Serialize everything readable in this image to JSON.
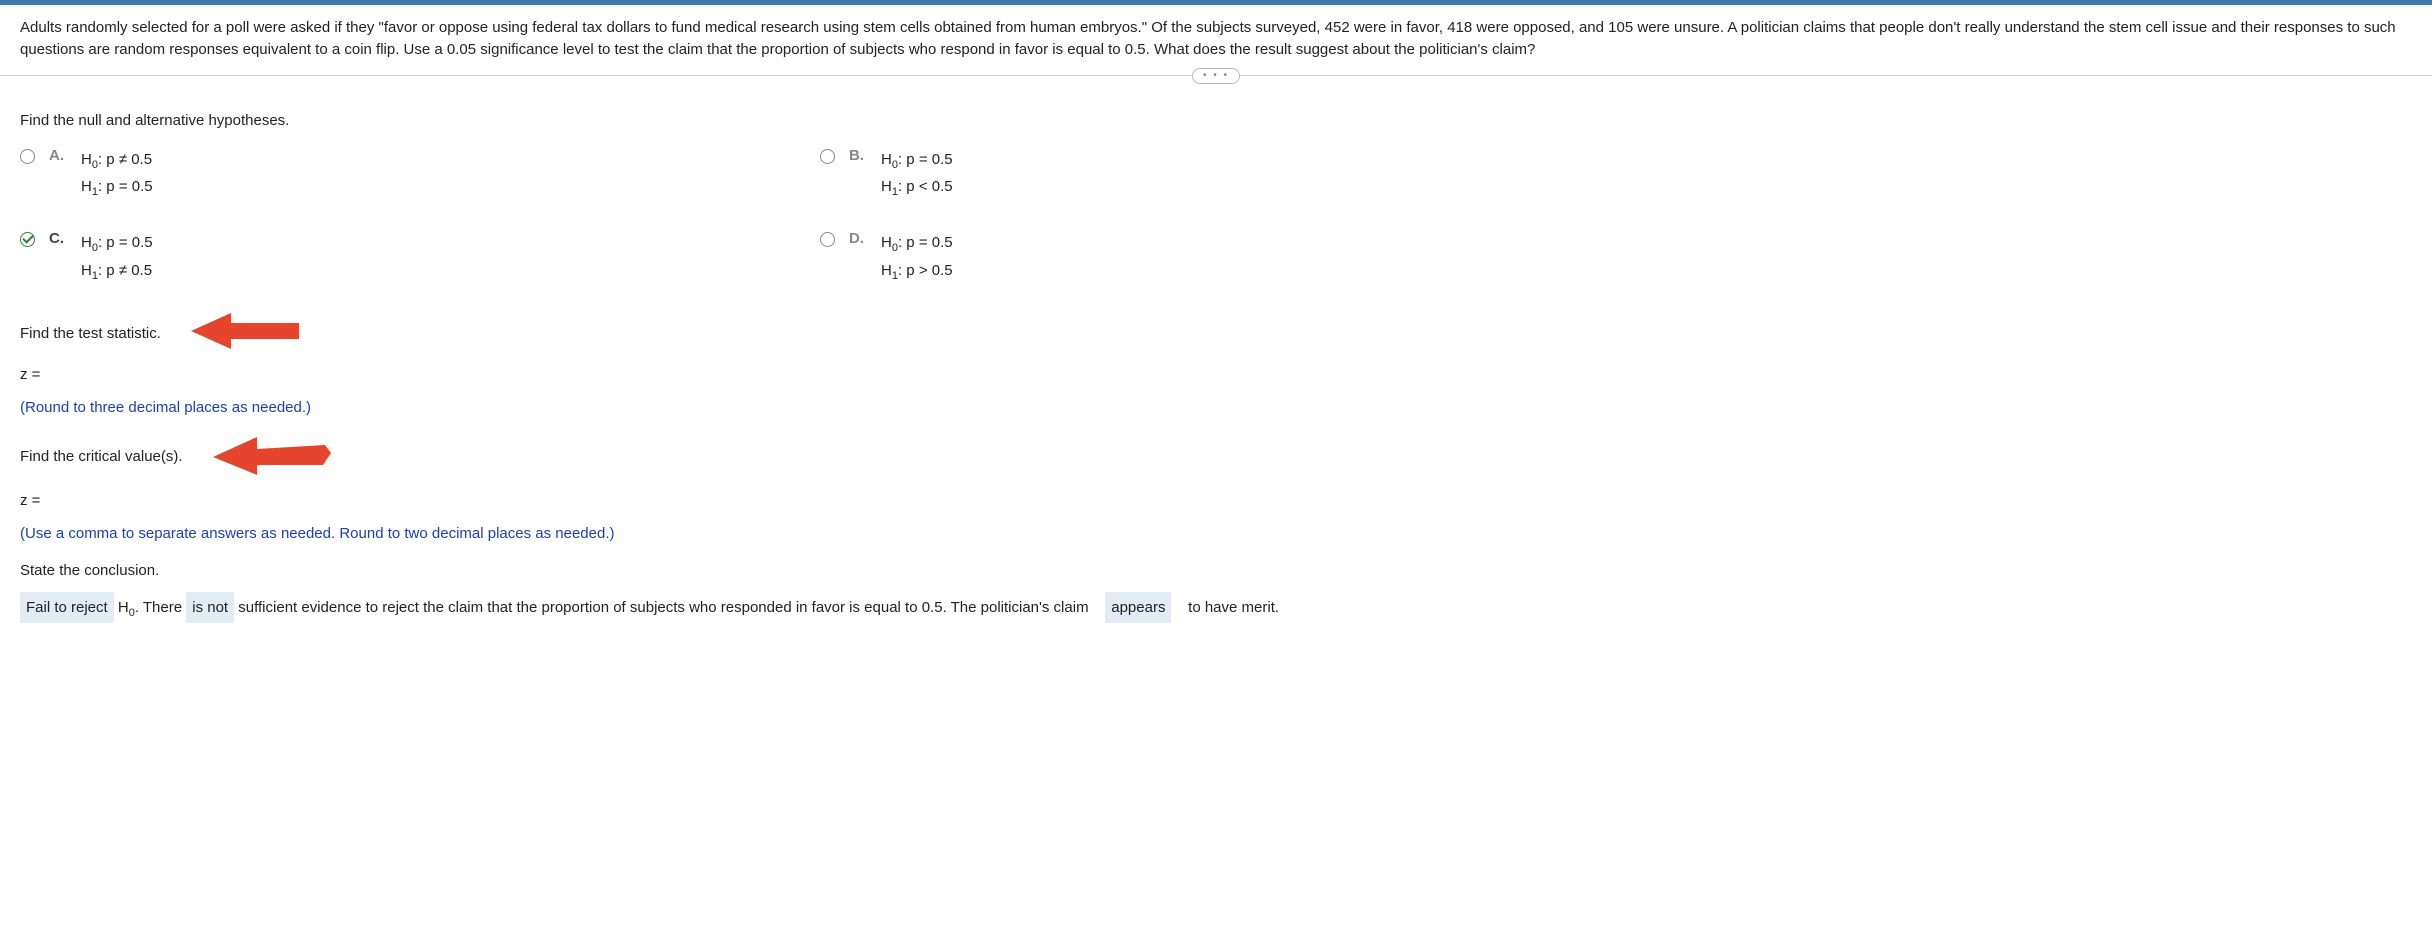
{
  "question": "Adults randomly selected for a poll were asked if they \"favor or oppose using federal tax dollars to fund medical research using stem cells obtained from human embryos.\" Of the subjects surveyed, 452 were in favor, 418 were opposed, and 105 were unsure. A politician claims that people don't really understand the stem cell issue and their responses to such questions are random responses equivalent to a coin flip. Use a 0.05 significance level to test the claim that the proportion of subjects who respond in favor is equal to 0.5. What does the result suggest about the politician's claim?",
  "ornament": "• • •",
  "prompts": {
    "find_hypotheses": "Find the null and alternative hypotheses.",
    "find_test_stat": "Find the test statistic.",
    "z_equals": "z =",
    "round3": "(Round to three decimal places as needed.)",
    "find_crit": "Find the critical value(s).",
    "round2": "(Use a comma to separate answers as needed. Round to two decimal places as needed.)",
    "state_conclusion": "State the conclusion."
  },
  "options": {
    "A": {
      "letter": "A.",
      "h0": "H",
      "h0sub": "0",
      "h0rest": ": p ≠ 0.5",
      "h1": "H",
      "h1sub": "1",
      "h1rest": ": p = 0.5"
    },
    "B": {
      "letter": "B.",
      "h0": "H",
      "h0sub": "0",
      "h0rest": ": p = 0.5",
      "h1": "H",
      "h1sub": "1",
      "h1rest": ": p < 0.5"
    },
    "C": {
      "letter": "C.",
      "h0": "H",
      "h0sub": "0",
      "h0rest": ": p = 0.5",
      "h1": "H",
      "h1sub": "1",
      "h1rest": ": p ≠ 0.5"
    },
    "D": {
      "letter": "D.",
      "h0": "H",
      "h0sub": "0",
      "h0rest": ": p = 0.5",
      "h1": "H",
      "h1sub": "1",
      "h1rest": ": p > 0.5"
    }
  },
  "conclusion": {
    "blank1": "Fail to reject",
    "mid1a": " H",
    "mid1sub": "0",
    "mid1b": ". There ",
    "blank2": "is not",
    "mid2": " sufficient evidence to reject the claim that the proportion of subjects who responded in favor is equal to 0.5. The politician's claim ",
    "blank3": "appears",
    "mid3": " to have merit."
  }
}
